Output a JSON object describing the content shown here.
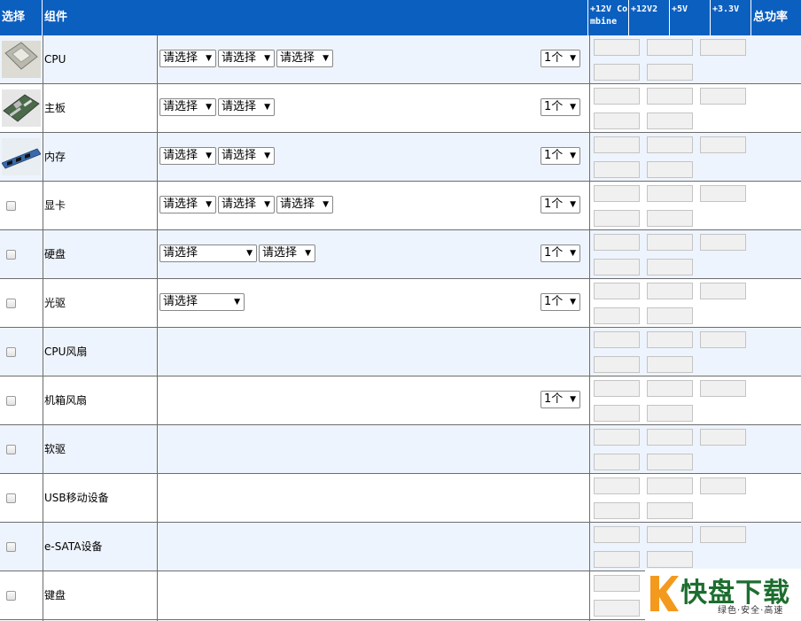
{
  "header": {
    "select": "选择",
    "component": "组件",
    "v12_combine": "+12V Co mbine",
    "v12_2": "+12V2",
    "v5": "+5V",
    "v33": "+3.3V",
    "total": "总功率"
  },
  "placeholder": "请选择",
  "qty": "1个",
  "rows": [
    {
      "name": "CPU",
      "image": "cpu-chip",
      "selects": [
        60,
        60,
        60
      ],
      "qty": true
    },
    {
      "name": "主板",
      "image": "motherboard",
      "selects": [
        60,
        60
      ],
      "qty": true
    },
    {
      "name": "内存",
      "image": "memory-module",
      "selects": [
        60,
        60
      ],
      "qty": true
    },
    {
      "name": "显卡",
      "image": "",
      "selects": [
        60,
        60,
        60
      ],
      "qty": true
    },
    {
      "name": "硬盘",
      "image": "",
      "selects": [
        106,
        60
      ],
      "qty": true
    },
    {
      "name": "光驱",
      "image": "",
      "selects": [
        92
      ],
      "qty": true
    },
    {
      "name": "CPU风扇",
      "image": "",
      "selects": [],
      "qty": false
    },
    {
      "name": "机箱风扇",
      "image": "",
      "selects": [],
      "qty": true
    },
    {
      "name": "软驱",
      "image": "",
      "selects": [],
      "qty": false
    },
    {
      "name": "USB移动设备",
      "image": "",
      "selects": [],
      "qty": false
    },
    {
      "name": "e-SATA设备",
      "image": "",
      "selects": [],
      "qty": false
    },
    {
      "name": "键盘",
      "image": "",
      "selects": [],
      "qty": false
    }
  ],
  "watermark": {
    "title": "快盘下载",
    "tagline": "绿色·安全·高速"
  },
  "colors": {
    "header": "#0b5fbf",
    "alt_row": "#eef4fd",
    "brand_green": "#1d6d2f",
    "brand_orange": "#f39a1e"
  }
}
